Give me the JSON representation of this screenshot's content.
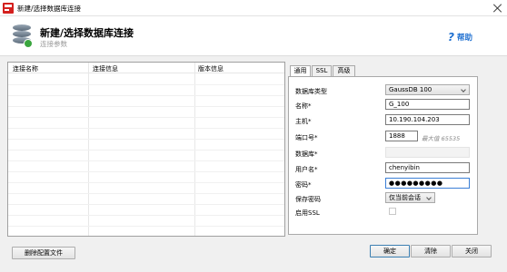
{
  "window": {
    "title": "新建/选择数据库连接"
  },
  "header": {
    "title": "新建/选择数据库连接",
    "subtitle": "连接参数",
    "help_label": "帮助"
  },
  "list": {
    "columns": [
      "连接名称",
      "连接信息",
      "版本信息"
    ],
    "delete_button": "删除配置文件"
  },
  "tabs": [
    "通用",
    "SSL",
    "高级"
  ],
  "form": {
    "db_type_label": "数据库类型",
    "db_type_value": "GaussDB 100",
    "name_label": "名称*",
    "name_value": "G_100",
    "host_label": "主机*",
    "host_value": "10.190.104.203",
    "port_label": "端口号*",
    "port_value": "1888",
    "port_hint": "最大值 65535",
    "database_label": "数据库*",
    "database_value": "",
    "user_label": "用户名*",
    "user_value": "chenyibin",
    "password_label": "密码*",
    "password_value": "●●●●●●●●●",
    "save_password_label": "保存密码",
    "save_password_value": "仅当前会话",
    "ssl_label": "启用SSL"
  },
  "buttons": {
    "ok": "确定",
    "clear": "清除",
    "close": "关闭"
  }
}
